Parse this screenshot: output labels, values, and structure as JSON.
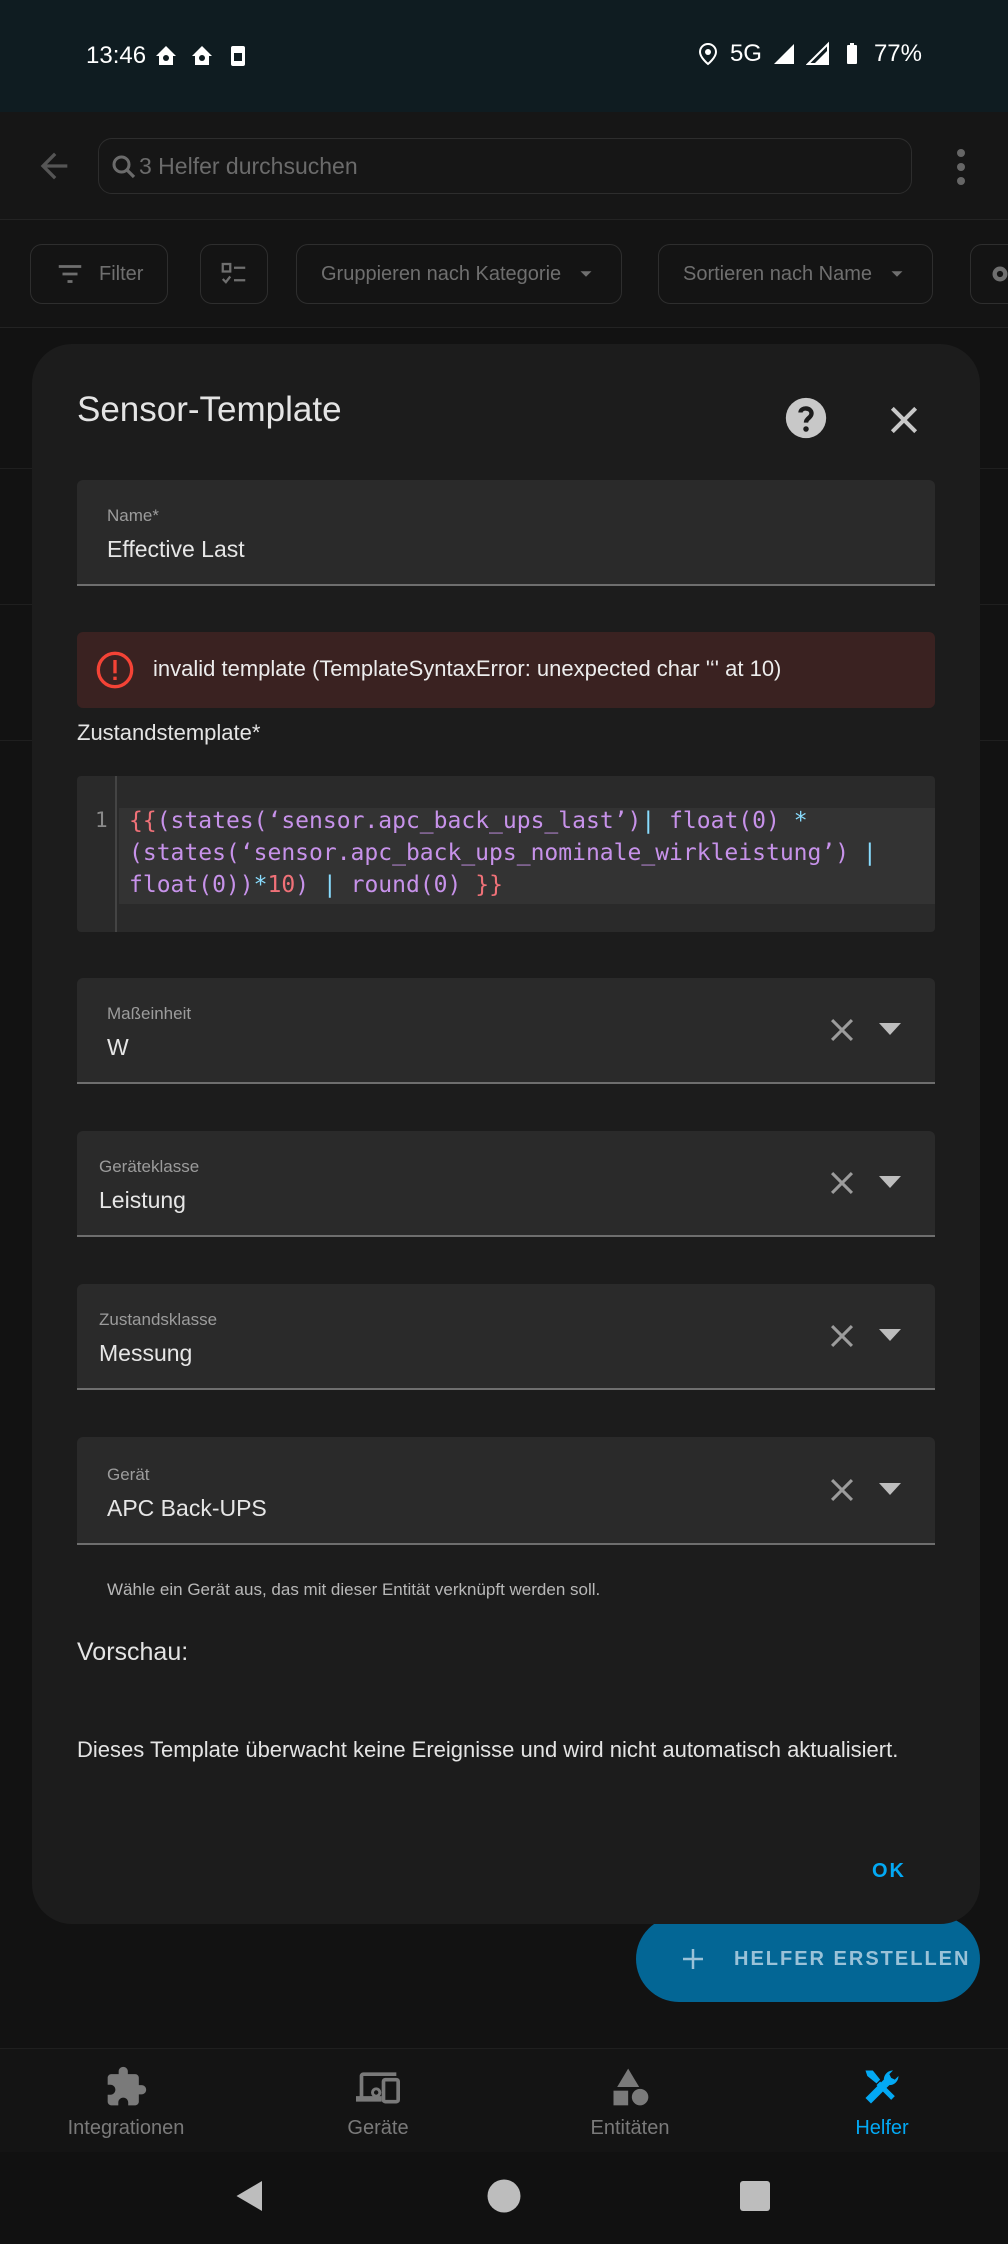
{
  "status_bar": {
    "time": "13:46",
    "network": "5G",
    "battery": "77%"
  },
  "app_bar": {
    "search_placeholder": "3 Helfer durchsuchen"
  },
  "toolbar": {
    "filter_label": "Filter",
    "group_label": "Gruppieren nach Kategorie",
    "sort_label": "Sortieren nach Name"
  },
  "dialog": {
    "title": "Sensor-Template",
    "name_field": {
      "label": "Name*",
      "value": "Effective Last"
    },
    "error_message": "invalid template (TemplateSyntaxError: unexpected char '‘' at 10)",
    "state_template_label": "Zustandstemplate*",
    "code": {
      "line_number": "1",
      "line1": [
        "{{",
        "(states(‘sensor.apc_back_ups_last’)",
        "|",
        " float(0) ",
        "*"
      ],
      "line2": [
        "(states(‘sensor.apc_back_ups_nominale_wirkleistung’) ",
        "|"
      ],
      "line3": [
        "float(0))",
        "*",
        "10",
        ") ",
        "|",
        " round(0) ",
        "}}"
      ]
    },
    "unit_field": {
      "label": "Maßeinheit",
      "value": "W"
    },
    "device_class_field": {
      "label": "Geräteklasse",
      "value": "Leistung"
    },
    "state_class_field": {
      "label": "Zustandsklasse",
      "value": "Messung"
    },
    "device_field": {
      "label": "Gerät",
      "value": "APC Back-UPS",
      "helper": "Wähle ein Gerät aus, das mit dieser Entität verknüpft werden soll."
    },
    "preview_title": "Vorschau:",
    "preview_text": "Dieses Template überwacht keine Ereignisse und wird nicht automatisch aktualisiert.",
    "ok_label": "OK"
  },
  "fab": {
    "label": "HELFER ERSTELLEN"
  },
  "bottom_nav": {
    "items": [
      {
        "label": "Integrationen",
        "icon": "puzzle-icon"
      },
      {
        "label": "Geräte",
        "icon": "devices-icon"
      },
      {
        "label": "Entitäten",
        "icon": "shapes-icon"
      },
      {
        "label": "Helfer",
        "icon": "tools-icon",
        "active": true
      }
    ]
  },
  "colors": {
    "accent": "#03a9f4",
    "error_bg": "#3a2221",
    "error_icon": "#f44336"
  }
}
